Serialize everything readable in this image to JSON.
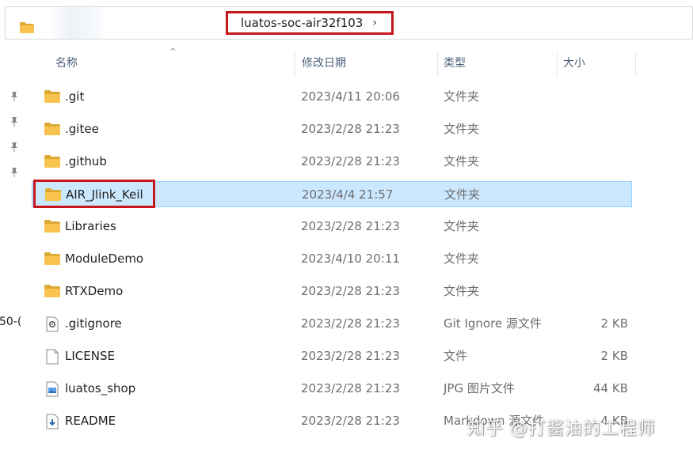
{
  "address_bar": {
    "current_folder": "luatos-soc-air32f103",
    "chevron": "›"
  },
  "nav": {
    "pins": [
      "pin-icon",
      "pin-icon",
      "pin-icon",
      "pin-icon"
    ],
    "partial_text": "50-("
  },
  "columns": {
    "name": "名称",
    "date": "修改日期",
    "type": "类型",
    "size": "大小"
  },
  "files": [
    {
      "name": ".git",
      "date": "2023/4/11 20:06",
      "type": "文件夹",
      "size": "",
      "icon": "folder-icon"
    },
    {
      "name": ".gitee",
      "date": "2023/2/28 21:23",
      "type": "文件夹",
      "size": "",
      "icon": "folder-icon"
    },
    {
      "name": ".github",
      "date": "2023/2/28 21:23",
      "type": "文件夹",
      "size": "",
      "icon": "folder-icon"
    },
    {
      "name": "AIR_Jlink_Keil",
      "date": "2023/4/4 21:57",
      "type": "文件夹",
      "size": "",
      "icon": "folder-icon",
      "selected": true
    },
    {
      "name": "Libraries",
      "date": "2023/2/28 21:23",
      "type": "文件夹",
      "size": "",
      "icon": "folder-icon"
    },
    {
      "name": "ModuleDemo",
      "date": "2023/4/10 20:11",
      "type": "文件夹",
      "size": "",
      "icon": "folder-icon"
    },
    {
      "name": "RTXDemo",
      "date": "2023/2/28 21:23",
      "type": "文件夹",
      "size": "",
      "icon": "folder-icon"
    },
    {
      "name": ".gitignore",
      "date": "2023/2/28 21:23",
      "type": "Git Ignore 源文件",
      "size": "2 KB",
      "icon": "settings-file-icon"
    },
    {
      "name": "LICENSE",
      "date": "2023/2/28 21:23",
      "type": "文件",
      "size": "2 KB",
      "icon": "blank-file-icon"
    },
    {
      "name": "luatos_shop",
      "date": "2023/2/28 21:23",
      "type": "JPG 图片文件",
      "size": "44 KB",
      "icon": "image-file-icon"
    },
    {
      "name": "README",
      "date": "2023/2/28 21:23",
      "type": "Markdown 源文件",
      "size": "4 KB",
      "icon": "markdown-file-icon"
    }
  ],
  "watermark": "知乎 @打酱油的工程师",
  "colors": {
    "selection_bg": "#cce8ff",
    "selection_border": "#99d1ff",
    "highlight_box": "#c8161d",
    "folder_yellow": "#f8c44f"
  }
}
